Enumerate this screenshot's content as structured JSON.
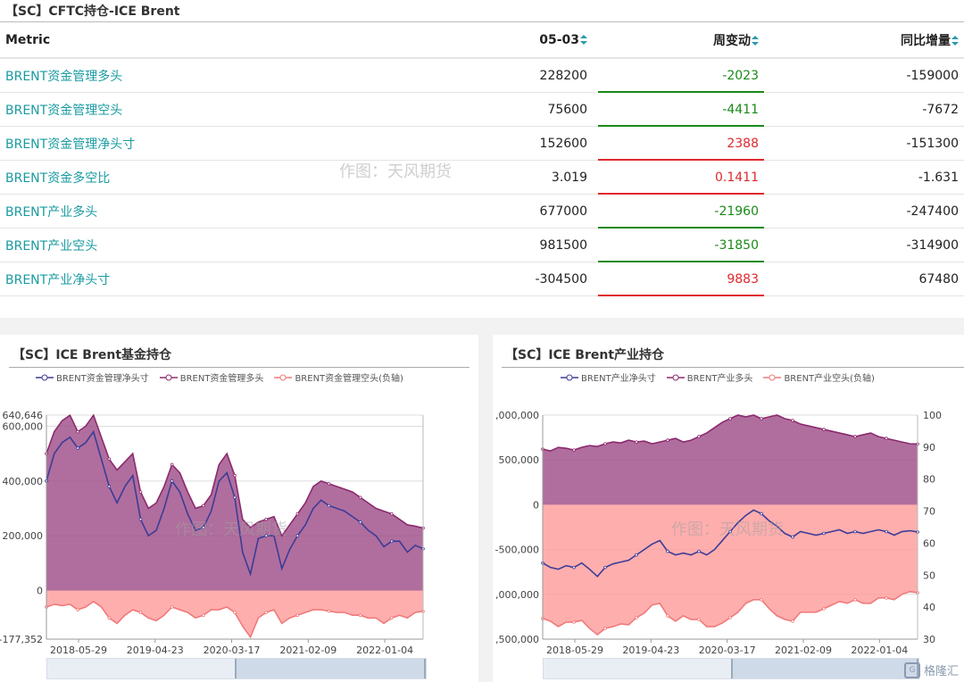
{
  "table": {
    "title": "【SC】CFTC持仓-ICE Brent",
    "watermark": "作图：天风期货",
    "headers": {
      "metric": "Metric",
      "date": "05-03",
      "week": "周变动",
      "yoy": "同比增量"
    },
    "rows": [
      {
        "metric": "BRENT资金管理多头",
        "date": "228200",
        "week": "-2023",
        "yoy": "-159000",
        "dir": "down"
      },
      {
        "metric": "BRENT资金管理空头",
        "date": "75600",
        "week": "-4411",
        "yoy": "-7672",
        "dir": "down"
      },
      {
        "metric": "BRENT资金管理净头寸",
        "date": "152600",
        "week": "2388",
        "yoy": "-151300",
        "dir": "up"
      },
      {
        "metric": "BRENT资金多空比",
        "date": "3.019",
        "week": "0.1411",
        "yoy": "-1.631",
        "dir": "up"
      },
      {
        "metric": "BRENT产业多头",
        "date": "677000",
        "week": "-21960",
        "yoy": "-247400",
        "dir": "down"
      },
      {
        "metric": "BRENT产业空头",
        "date": "981500",
        "week": "-31850",
        "yoy": "-314900",
        "dir": "down"
      },
      {
        "metric": "BRENT产业净头寸",
        "date": "-304500",
        "week": "9883",
        "yoy": "67480",
        "dir": "up"
      }
    ],
    "colors": {
      "up": "#e0282e",
      "down": "#1a8a1a",
      "metric": "#1a9ba1"
    }
  },
  "left_panel": {
    "title": "【SC】ICE Brent基金持仓",
    "watermark": "作图：天风期货",
    "legend": [
      "BRENT资金管理净头寸",
      "BRENT资金管理多头",
      "BRENT资金管理空头(负轴)"
    ],
    "y_ticks": [
      "640,646",
      "600,000",
      "400,000",
      "200,000",
      "0",
      "-177,352"
    ],
    "x_ticks": [
      "2018-05-29",
      "2019-04-23",
      "2020-03-17",
      "2021-02-09",
      "2022-01-04"
    ]
  },
  "right_panel": {
    "title": "【SC】ICE Brent产业持仓",
    "watermark": "作图：天风期货",
    "legend": [
      "BRENT产业净头寸",
      "BRENT产业多头",
      "BRENT产业空头(负轴)"
    ],
    "y_ticks": [
      ",000,000",
      "500,000",
      "0",
      "-500,000",
      ",000,000",
      ",500,000"
    ],
    "y2_ticks": [
      "100",
      "90",
      "80",
      "70",
      "60",
      "50",
      "40",
      "30"
    ],
    "x_ticks": [
      "2018-05-29",
      "2019-04-23",
      "2020-03-17",
      "2021-02-09",
      "2022-01-04"
    ]
  },
  "chart_data": [
    {
      "type": "area",
      "title": "【SC】ICE Brent基金持仓",
      "ylim": [
        -177352,
        640646
      ],
      "x_ticks": [
        "2018-05-29",
        "2019-04-23",
        "2020-03-17",
        "2021-02-09",
        "2022-01-04"
      ],
      "series": [
        {
          "name": "BRENT资金管理多头",
          "color": "#8b2a6e",
          "values": [
            500000,
            580000,
            620000,
            640000,
            580000,
            600000,
            640000,
            560000,
            480000,
            440000,
            470000,
            500000,
            360000,
            300000,
            320000,
            380000,
            460000,
            430000,
            360000,
            300000,
            310000,
            350000,
            460000,
            500000,
            420000,
            260000,
            230000,
            250000,
            260000,
            270000,
            200000,
            240000,
            280000,
            320000,
            380000,
            400000,
            390000,
            380000,
            370000,
            360000,
            340000,
            320000,
            300000,
            290000,
            280000,
            260000,
            240000,
            235000,
            228200
          ]
        },
        {
          "name": "BRENT资金管理净头寸",
          "color": "#3c3c96",
          "values": [
            400000,
            500000,
            540000,
            560000,
            520000,
            540000,
            580000,
            480000,
            380000,
            320000,
            380000,
            420000,
            260000,
            200000,
            220000,
            300000,
            400000,
            360000,
            280000,
            220000,
            230000,
            290000,
            400000,
            430000,
            340000,
            140000,
            60000,
            190000,
            200000,
            200000,
            80000,
            150000,
            200000,
            240000,
            300000,
            330000,
            310000,
            300000,
            290000,
            270000,
            250000,
            220000,
            200000,
            160000,
            180000,
            180000,
            140000,
            165000,
            152600
          ]
        },
        {
          "name": "BRENT资金管理空头(负轴)",
          "color": "#f07a7a",
          "values": [
            -60000,
            -50000,
            -55000,
            -50000,
            -70000,
            -60000,
            -40000,
            -60000,
            -100000,
            -120000,
            -90000,
            -70000,
            -80000,
            -100000,
            -110000,
            -90000,
            -60000,
            -70000,
            -80000,
            -100000,
            -90000,
            -70000,
            -70000,
            -60000,
            -80000,
            -130000,
            -170000,
            -100000,
            -80000,
            -70000,
            -120000,
            -100000,
            -90000,
            -80000,
            -70000,
            -70000,
            -75000,
            -80000,
            -80000,
            -90000,
            -90000,
            -100000,
            -100000,
            -120000,
            -100000,
            -90000,
            -100000,
            -80000,
            -75600
          ]
        }
      ]
    },
    {
      "type": "area",
      "title": "【SC】ICE Brent产业持仓",
      "ylim": [
        -1500000,
        1000000
      ],
      "x_ticks": [
        "2018-05-29",
        "2019-04-23",
        "2020-03-17",
        "2021-02-09",
        "2022-01-04"
      ],
      "series": [
        {
          "name": "BRENT产业多头",
          "color": "#8b2a6e",
          "values": [
            620000,
            600000,
            640000,
            630000,
            610000,
            640000,
            660000,
            650000,
            680000,
            700000,
            690000,
            720000,
            700000,
            710000,
            680000,
            700000,
            720000,
            740000,
            700000,
            720000,
            760000,
            800000,
            860000,
            920000,
            960000,
            1000000,
            980000,
            1000000,
            960000,
            980000,
            1000000,
            960000,
            940000,
            900000,
            880000,
            860000,
            840000,
            820000,
            800000,
            780000,
            760000,
            780000,
            800000,
            760000,
            740000,
            720000,
            700000,
            680000,
            677000
          ]
        },
        {
          "name": "BRENT产业净头寸",
          "color": "#3c3c96",
          "values": [
            -650000,
            -700000,
            -720000,
            -680000,
            -700000,
            -650000,
            -720000,
            -800000,
            -700000,
            -660000,
            -640000,
            -620000,
            -560000,
            -500000,
            -440000,
            -400000,
            -520000,
            -560000,
            -540000,
            -560000,
            -520000,
            -560000,
            -500000,
            -400000,
            -300000,
            -200000,
            -120000,
            -60000,
            -100000,
            -180000,
            -240000,
            -320000,
            -360000,
            -300000,
            -320000,
            -340000,
            -320000,
            -300000,
            -280000,
            -320000,
            -300000,
            -320000,
            -300000,
            -280000,
            -300000,
            -340000,
            -300000,
            -290000,
            -304500
          ]
        },
        {
          "name": "BRENT产业空头(负轴)",
          "color": "#f07a7a",
          "values": [
            -1270000,
            -1300000,
            -1360000,
            -1310000,
            -1310000,
            -1290000,
            -1380000,
            -1450000,
            -1380000,
            -1360000,
            -1330000,
            -1340000,
            -1260000,
            -1210000,
            -1120000,
            -1100000,
            -1240000,
            -1300000,
            -1240000,
            -1280000,
            -1280000,
            -1360000,
            -1360000,
            -1320000,
            -1260000,
            -1200000,
            -1100000,
            -1060000,
            -1060000,
            -1160000,
            -1240000,
            -1280000,
            -1300000,
            -1200000,
            -1200000,
            -1200000,
            -1160000,
            -1120000,
            -1080000,
            -1100000,
            -1060000,
            -1100000,
            -1100000,
            -1040000,
            -1040000,
            -1060000,
            -1000000,
            -970000,
            -981500
          ]
        }
      ]
    }
  ],
  "footer": {
    "logo": "格隆汇"
  }
}
